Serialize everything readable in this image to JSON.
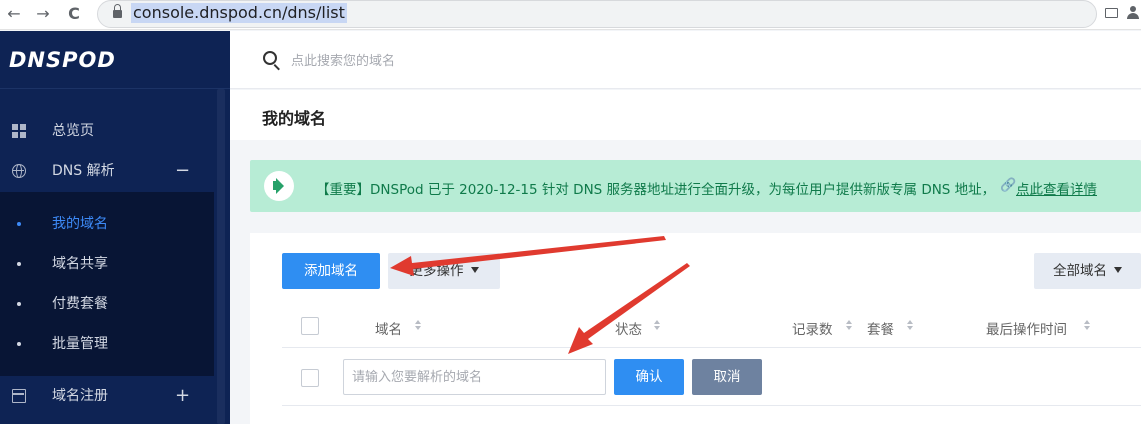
{
  "browser": {
    "back_glyph": "←",
    "forward_glyph": "→",
    "reload_glyph": "C",
    "url": "console.dnspod.cn/dns/list"
  },
  "sidebar": {
    "logo": "DNSPOD",
    "items": [
      {
        "label": "总览页",
        "icon": "grid-icon"
      },
      {
        "label": "DNS 解析",
        "icon": "globe-icon",
        "control": "−"
      },
      {
        "label": "域名注册",
        "icon": "calendar-icon",
        "control": "+"
      }
    ],
    "subitems": [
      {
        "label": "我的域名",
        "active": true
      },
      {
        "label": "域名共享"
      },
      {
        "label": "付费套餐"
      },
      {
        "label": "批量管理"
      }
    ]
  },
  "header": {
    "search_placeholder": "点此搜索您的域名",
    "page_title": "我的域名"
  },
  "notice": {
    "icon": "speaker-icon",
    "text": "【重要】DNSPod 已于 2020-12-15 针对 DNS 服务器地址进行全面升级，为每位用户提供新版专属 DNS 地址，",
    "link_glyph": "🔗",
    "link": "点此查看详情"
  },
  "toolbar": {
    "add_domain": "添加域名",
    "more_actions": "更多操作",
    "filter": "全部域名"
  },
  "table": {
    "columns": [
      "域名",
      "状态",
      "记录数",
      "套餐",
      "最后操作时间"
    ]
  },
  "add_row": {
    "placeholder": "请输入您要解析的域名",
    "confirm": "确认",
    "cancel": "取消"
  },
  "colors": {
    "sidebar_bg": "#0e2354",
    "accent_blue": "#2f8ef2",
    "notice_bg": "#b7ecd5",
    "arrow_red": "#e03a2f"
  }
}
